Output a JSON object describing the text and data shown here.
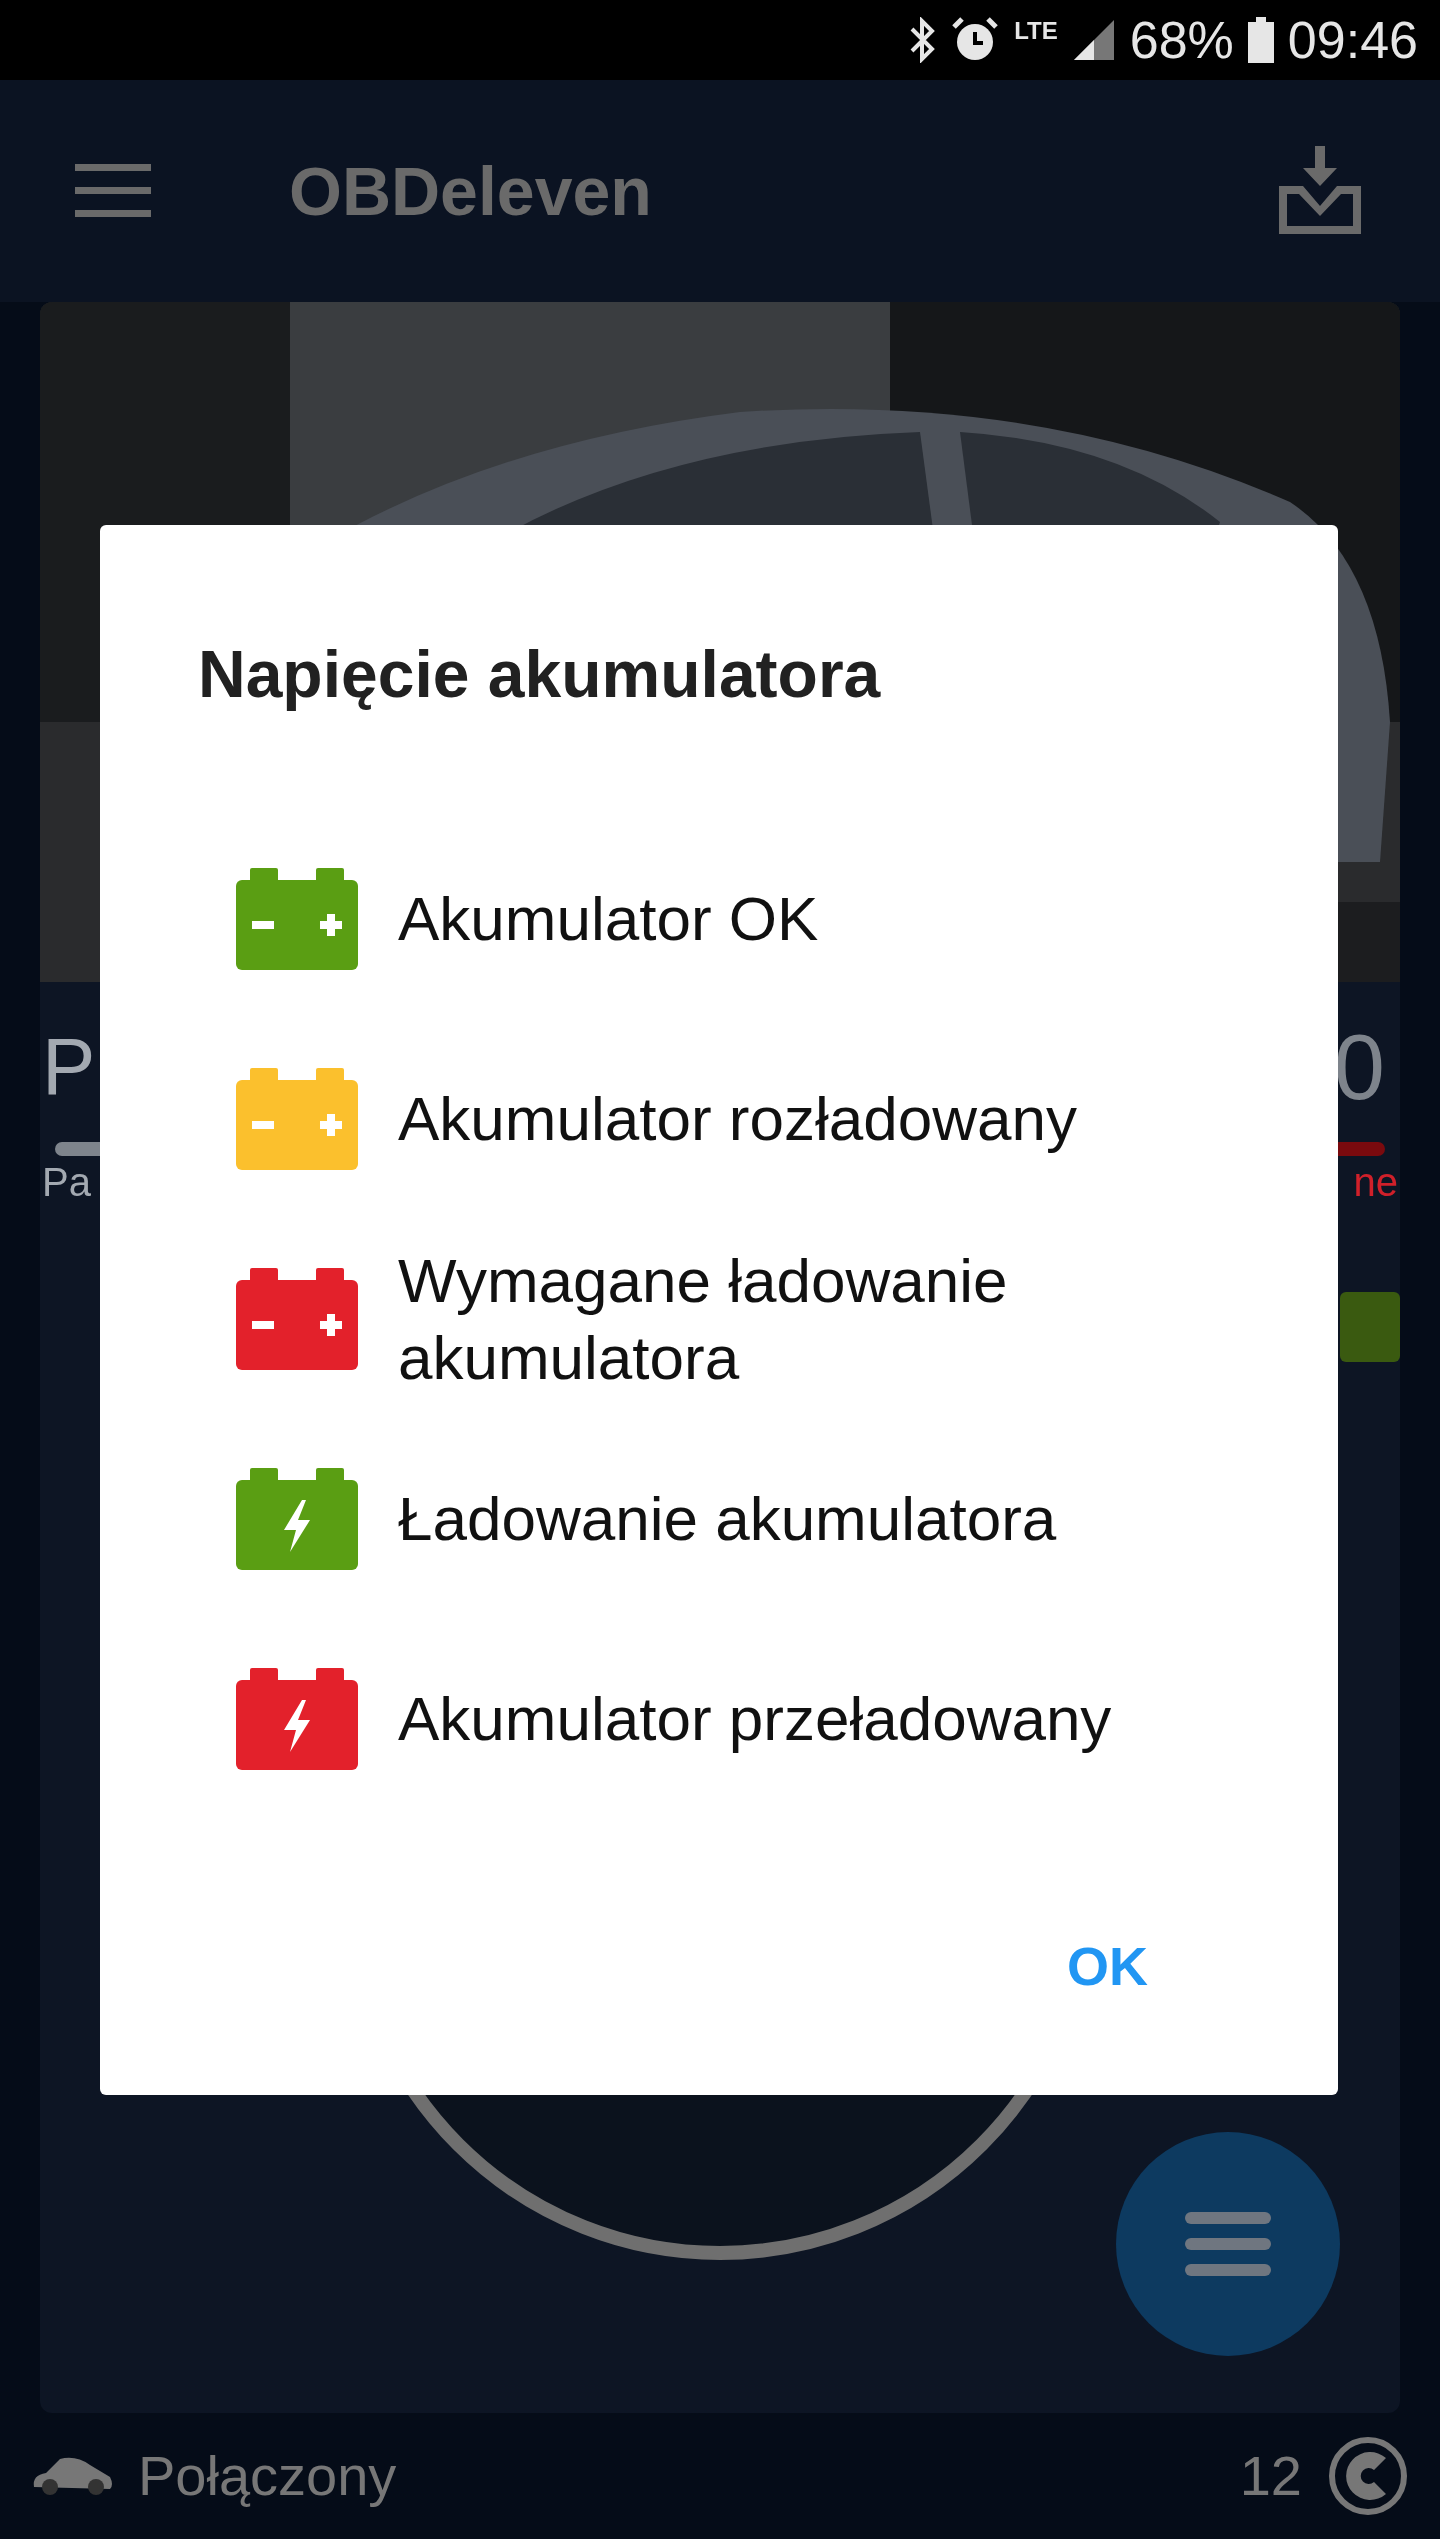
{
  "status_bar": {
    "network": "LTE",
    "battery": "68%",
    "time": "09:46"
  },
  "app_bar": {
    "title": "OBDeleven"
  },
  "dashboard": {
    "left_value": "P",
    "left_label": "Pa",
    "right_value": "0",
    "right_label": "ne",
    "status_text": "Połączony",
    "count": "12"
  },
  "dialog": {
    "title": "Napięcie akumulatora",
    "items": [
      {
        "label": "Akumulator OK",
        "kind": "terminals",
        "color": "#5a9e13"
      },
      {
        "label": "Akumulator rozładowany",
        "kind": "terminals",
        "color": "#fbc02d"
      },
      {
        "label": "Wymagane ładowanie akumulatora",
        "kind": "terminals",
        "color": "#e3212b"
      },
      {
        "label": "Ładowanie akumulatora",
        "kind": "bolt",
        "color": "#5a9e13"
      },
      {
        "label": "Akumulator przeładowany",
        "kind": "bolt",
        "color": "#e3212b"
      }
    ],
    "button": "OK"
  }
}
